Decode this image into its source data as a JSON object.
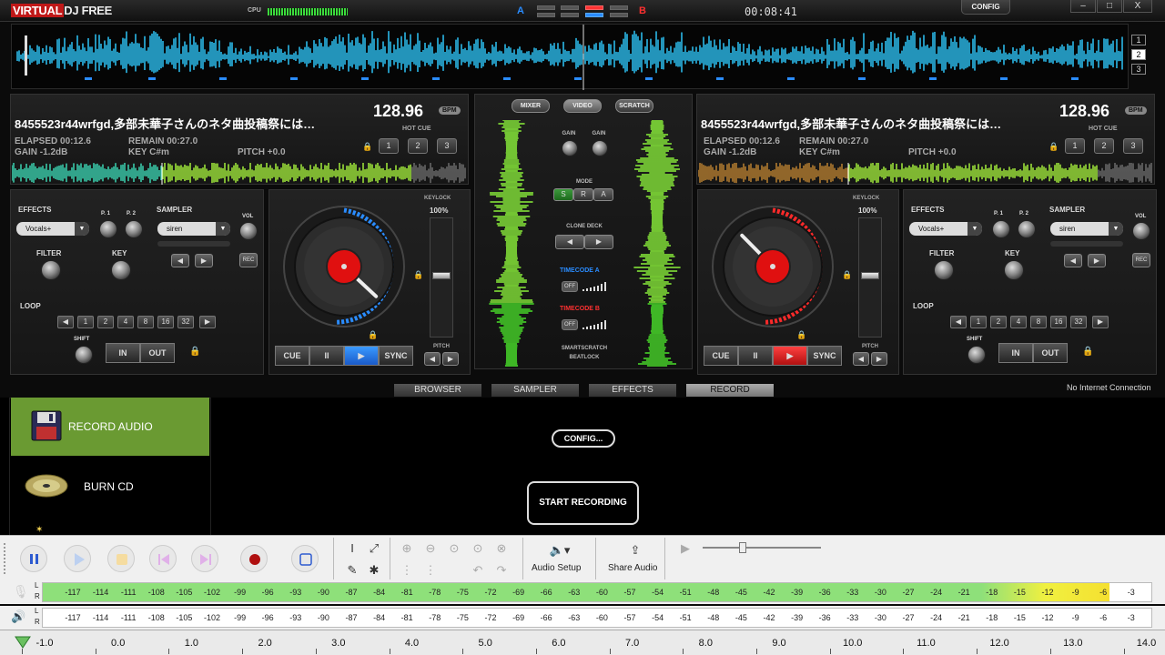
{
  "app": {
    "logo_a": "VIRTUAL",
    "logo_b": "DJ FREE",
    "cpu_label": "CPU",
    "clock": "00:08:41",
    "config": "CONFIG",
    "xf_a": "A",
    "xf_b": "B",
    "min": "–",
    "max": "□",
    "close": "X"
  },
  "overview": {
    "decks": [
      "1",
      "2",
      "3"
    ],
    "active_deck": "2"
  },
  "deck_left": {
    "title": "8455523r44wrfgd,多部未華子さんのネタ曲投稿祭には…",
    "bpm": "128.96",
    "bpm_label": "BPM",
    "elapsed": "ELAPSED 00:12.6",
    "remain": "REMAIN 00:27.0",
    "gain": "GAIN -1.2dB",
    "key": "KEY C#m",
    "pitch": "PITCH +0.0",
    "hotcue_label": "HOT CUE",
    "hotcues": [
      "1",
      "2",
      "3"
    ],
    "effects_label": "EFFECTS",
    "effect": "Vocals+",
    "p1": "P. 1",
    "p2": "P. 2",
    "sampler_label": "SAMPLER",
    "sample": "siren",
    "vol": "VOL",
    "rec": "REC",
    "filter": "FILTER",
    "key_label": "KEY",
    "loop_label": "LOOP",
    "loops": [
      "1",
      "2",
      "4",
      "8",
      "16",
      "32"
    ],
    "shift": "SHIFT",
    "in": "IN",
    "out": "OUT",
    "keylock": "KEYLOCK",
    "pitch_pct": "100%",
    "pitch_label": "PITCH",
    "cue": "CUE",
    "pause": "II",
    "play": "▶",
    "sync": "SYNC",
    "accent": "#2a8cff"
  },
  "deck_right": {
    "title": "8455523r44wrfgd,多部未華子さんのネタ曲投稿祭には…",
    "bpm": "128.96",
    "bpm_label": "BPM",
    "elapsed": "ELAPSED 00:12.6",
    "remain": "REMAIN 00:27.0",
    "gain": "GAIN -1.2dB",
    "key": "KEY C#m",
    "pitch": "PITCH +0.0",
    "hotcue_label": "HOT CUE",
    "hotcues": [
      "1",
      "2",
      "3"
    ],
    "effects_label": "EFFECTS",
    "effect": "Vocals+",
    "p1": "P. 1",
    "p2": "P. 2",
    "sampler_label": "SAMPLER",
    "sample": "siren",
    "vol": "VOL",
    "rec": "REC",
    "filter": "FILTER",
    "key_label": "KEY",
    "loop_label": "LOOP",
    "loops": [
      "1",
      "2",
      "4",
      "8",
      "16",
      "32"
    ],
    "shift": "SHIFT",
    "in": "IN",
    "out": "OUT",
    "keylock": "KEYLOCK",
    "pitch_pct": "100%",
    "pitch_label": "PITCH",
    "cue": "CUE",
    "pause": "II",
    "play": "▶",
    "sync": "SYNC",
    "accent": "#ff2a2a"
  },
  "mixer": {
    "tabs": [
      "MIXER",
      "VIDEO",
      "SCRATCH"
    ],
    "active_tab": "VIDEO",
    "gain": "GAIN",
    "mode": "MODE",
    "modes": [
      "S",
      "R",
      "A"
    ],
    "clone_deck": "CLONE DECK",
    "timecode_a": "TIMECODE A",
    "timecode_b": "TIMECODE B",
    "off": "OFF",
    "smartscratch": "SMARTSCRATCH",
    "beatlock": "BEATLOCK"
  },
  "browser": {
    "tabs": [
      "BROWSER",
      "SAMPLER",
      "EFFECTS",
      "RECORD"
    ],
    "active": "RECORD",
    "status": "No Internet Connection"
  },
  "record": {
    "items": [
      "RECORD AUDIO",
      "BURN CD"
    ],
    "config_btn": "CONFIG...",
    "start_btn": "START RECORDING"
  },
  "audacity": {
    "audio_setup": "Audio Setup",
    "share_audio": "Share Audio",
    "meter_ticks": [
      "-117",
      "-114",
      "-111",
      "-108",
      "-105",
      "-102",
      "-99",
      "-96",
      "-93",
      "-90",
      "-87",
      "-84",
      "-81",
      "-78",
      "-75",
      "-72",
      "-69",
      "-66",
      "-63",
      "-60",
      "-57",
      "-54",
      "-51",
      "-48",
      "-45",
      "-42",
      "-39",
      "-36",
      "-33",
      "-30",
      "-27",
      "-24",
      "-21",
      "-18",
      "-15",
      "-12",
      "-9",
      "-6",
      "-3"
    ],
    "lr": [
      "L",
      "R"
    ],
    "record_meter_level_db": -6,
    "ruler": [
      "-1.0",
      "0.0",
      "1.0",
      "2.0",
      "3.0",
      "4.0",
      "5.0",
      "6.0",
      "7.0",
      "8.0",
      "9.0",
      "10.0",
      "11.0",
      "12.0",
      "13.0",
      "14.0"
    ]
  }
}
